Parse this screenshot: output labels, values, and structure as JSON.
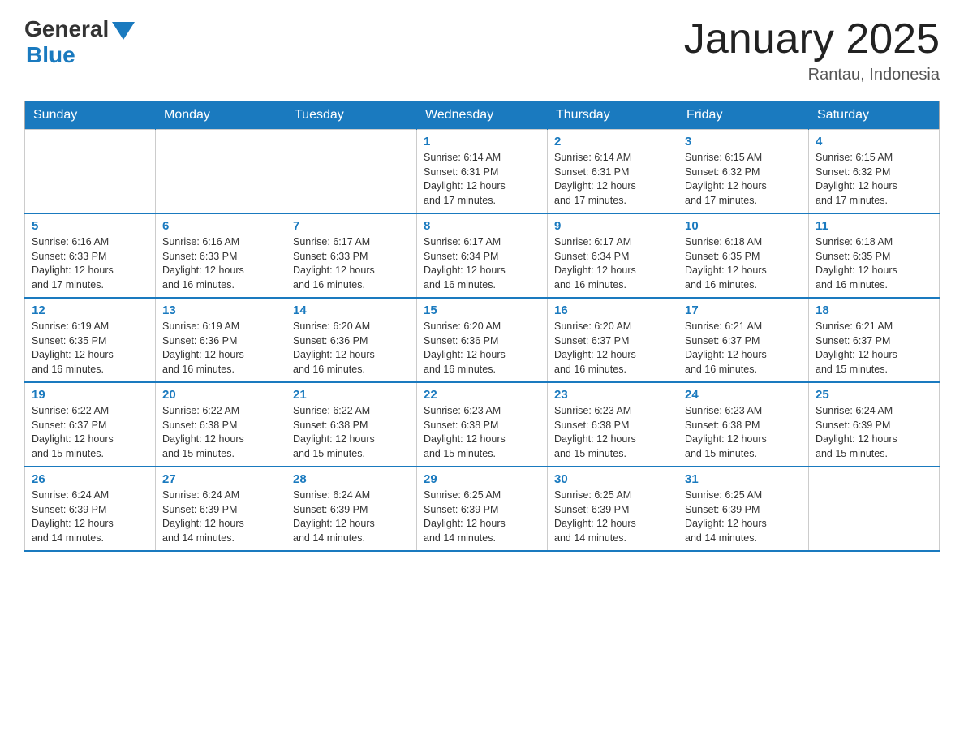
{
  "logo": {
    "general": "General",
    "blue": "Blue"
  },
  "title": "January 2025",
  "subtitle": "Rantau, Indonesia",
  "days": [
    "Sunday",
    "Monday",
    "Tuesday",
    "Wednesday",
    "Thursday",
    "Friday",
    "Saturday"
  ],
  "weeks": [
    [
      {
        "day": "",
        "info": ""
      },
      {
        "day": "",
        "info": ""
      },
      {
        "day": "",
        "info": ""
      },
      {
        "day": "1",
        "info": "Sunrise: 6:14 AM\nSunset: 6:31 PM\nDaylight: 12 hours\nand 17 minutes."
      },
      {
        "day": "2",
        "info": "Sunrise: 6:14 AM\nSunset: 6:31 PM\nDaylight: 12 hours\nand 17 minutes."
      },
      {
        "day": "3",
        "info": "Sunrise: 6:15 AM\nSunset: 6:32 PM\nDaylight: 12 hours\nand 17 minutes."
      },
      {
        "day": "4",
        "info": "Sunrise: 6:15 AM\nSunset: 6:32 PM\nDaylight: 12 hours\nand 17 minutes."
      }
    ],
    [
      {
        "day": "5",
        "info": "Sunrise: 6:16 AM\nSunset: 6:33 PM\nDaylight: 12 hours\nand 17 minutes."
      },
      {
        "day": "6",
        "info": "Sunrise: 6:16 AM\nSunset: 6:33 PM\nDaylight: 12 hours\nand 16 minutes."
      },
      {
        "day": "7",
        "info": "Sunrise: 6:17 AM\nSunset: 6:33 PM\nDaylight: 12 hours\nand 16 minutes."
      },
      {
        "day": "8",
        "info": "Sunrise: 6:17 AM\nSunset: 6:34 PM\nDaylight: 12 hours\nand 16 minutes."
      },
      {
        "day": "9",
        "info": "Sunrise: 6:17 AM\nSunset: 6:34 PM\nDaylight: 12 hours\nand 16 minutes."
      },
      {
        "day": "10",
        "info": "Sunrise: 6:18 AM\nSunset: 6:35 PM\nDaylight: 12 hours\nand 16 minutes."
      },
      {
        "day": "11",
        "info": "Sunrise: 6:18 AM\nSunset: 6:35 PM\nDaylight: 12 hours\nand 16 minutes."
      }
    ],
    [
      {
        "day": "12",
        "info": "Sunrise: 6:19 AM\nSunset: 6:35 PM\nDaylight: 12 hours\nand 16 minutes."
      },
      {
        "day": "13",
        "info": "Sunrise: 6:19 AM\nSunset: 6:36 PM\nDaylight: 12 hours\nand 16 minutes."
      },
      {
        "day": "14",
        "info": "Sunrise: 6:20 AM\nSunset: 6:36 PM\nDaylight: 12 hours\nand 16 minutes."
      },
      {
        "day": "15",
        "info": "Sunrise: 6:20 AM\nSunset: 6:36 PM\nDaylight: 12 hours\nand 16 minutes."
      },
      {
        "day": "16",
        "info": "Sunrise: 6:20 AM\nSunset: 6:37 PM\nDaylight: 12 hours\nand 16 minutes."
      },
      {
        "day": "17",
        "info": "Sunrise: 6:21 AM\nSunset: 6:37 PM\nDaylight: 12 hours\nand 16 minutes."
      },
      {
        "day": "18",
        "info": "Sunrise: 6:21 AM\nSunset: 6:37 PM\nDaylight: 12 hours\nand 15 minutes."
      }
    ],
    [
      {
        "day": "19",
        "info": "Sunrise: 6:22 AM\nSunset: 6:37 PM\nDaylight: 12 hours\nand 15 minutes."
      },
      {
        "day": "20",
        "info": "Sunrise: 6:22 AM\nSunset: 6:38 PM\nDaylight: 12 hours\nand 15 minutes."
      },
      {
        "day": "21",
        "info": "Sunrise: 6:22 AM\nSunset: 6:38 PM\nDaylight: 12 hours\nand 15 minutes."
      },
      {
        "day": "22",
        "info": "Sunrise: 6:23 AM\nSunset: 6:38 PM\nDaylight: 12 hours\nand 15 minutes."
      },
      {
        "day": "23",
        "info": "Sunrise: 6:23 AM\nSunset: 6:38 PM\nDaylight: 12 hours\nand 15 minutes."
      },
      {
        "day": "24",
        "info": "Sunrise: 6:23 AM\nSunset: 6:38 PM\nDaylight: 12 hours\nand 15 minutes."
      },
      {
        "day": "25",
        "info": "Sunrise: 6:24 AM\nSunset: 6:39 PM\nDaylight: 12 hours\nand 15 minutes."
      }
    ],
    [
      {
        "day": "26",
        "info": "Sunrise: 6:24 AM\nSunset: 6:39 PM\nDaylight: 12 hours\nand 14 minutes."
      },
      {
        "day": "27",
        "info": "Sunrise: 6:24 AM\nSunset: 6:39 PM\nDaylight: 12 hours\nand 14 minutes."
      },
      {
        "day": "28",
        "info": "Sunrise: 6:24 AM\nSunset: 6:39 PM\nDaylight: 12 hours\nand 14 minutes."
      },
      {
        "day": "29",
        "info": "Sunrise: 6:25 AM\nSunset: 6:39 PM\nDaylight: 12 hours\nand 14 minutes."
      },
      {
        "day": "30",
        "info": "Sunrise: 6:25 AM\nSunset: 6:39 PM\nDaylight: 12 hours\nand 14 minutes."
      },
      {
        "day": "31",
        "info": "Sunrise: 6:25 AM\nSunset: 6:39 PM\nDaylight: 12 hours\nand 14 minutes."
      },
      {
        "day": "",
        "info": ""
      }
    ]
  ]
}
